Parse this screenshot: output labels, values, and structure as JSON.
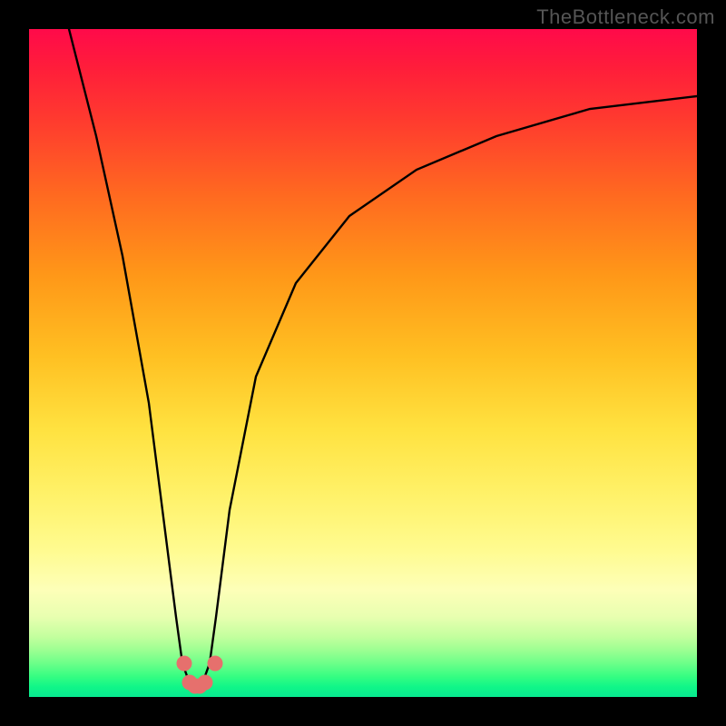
{
  "watermark": "TheBottleneck.com",
  "chart_data": {
    "type": "line",
    "title": "",
    "xlabel": "",
    "ylabel": "",
    "xlim": [
      0,
      100
    ],
    "ylim": [
      0,
      100
    ],
    "series": [
      {
        "name": "bottleneck-curve",
        "x": [
          6,
          10,
          14,
          18,
          20,
          22,
          23,
          24,
          25,
          26,
          27,
          28,
          30,
          34,
          40,
          48,
          58,
          70,
          84,
          100
        ],
        "values": [
          100,
          84,
          66,
          44,
          28,
          12,
          5,
          2,
          1.5,
          2,
          5,
          12,
          28,
          48,
          62,
          72,
          79,
          84,
          88,
          90
        ]
      }
    ],
    "accent_points": {
      "name": "trough-markers",
      "x": [
        23.2,
        24.0,
        24.8,
        25.6,
        26.4,
        27.8
      ],
      "values": [
        5.0,
        2.2,
        1.6,
        1.6,
        2.2,
        5.0
      ]
    },
    "colors": {
      "curve": "#000000",
      "markers": "#e6706d",
      "gradient_top": "#ff0a4a",
      "gradient_mid": "#ffe240",
      "gradient_bottom": "#08e990",
      "frame": "#000000"
    }
  }
}
